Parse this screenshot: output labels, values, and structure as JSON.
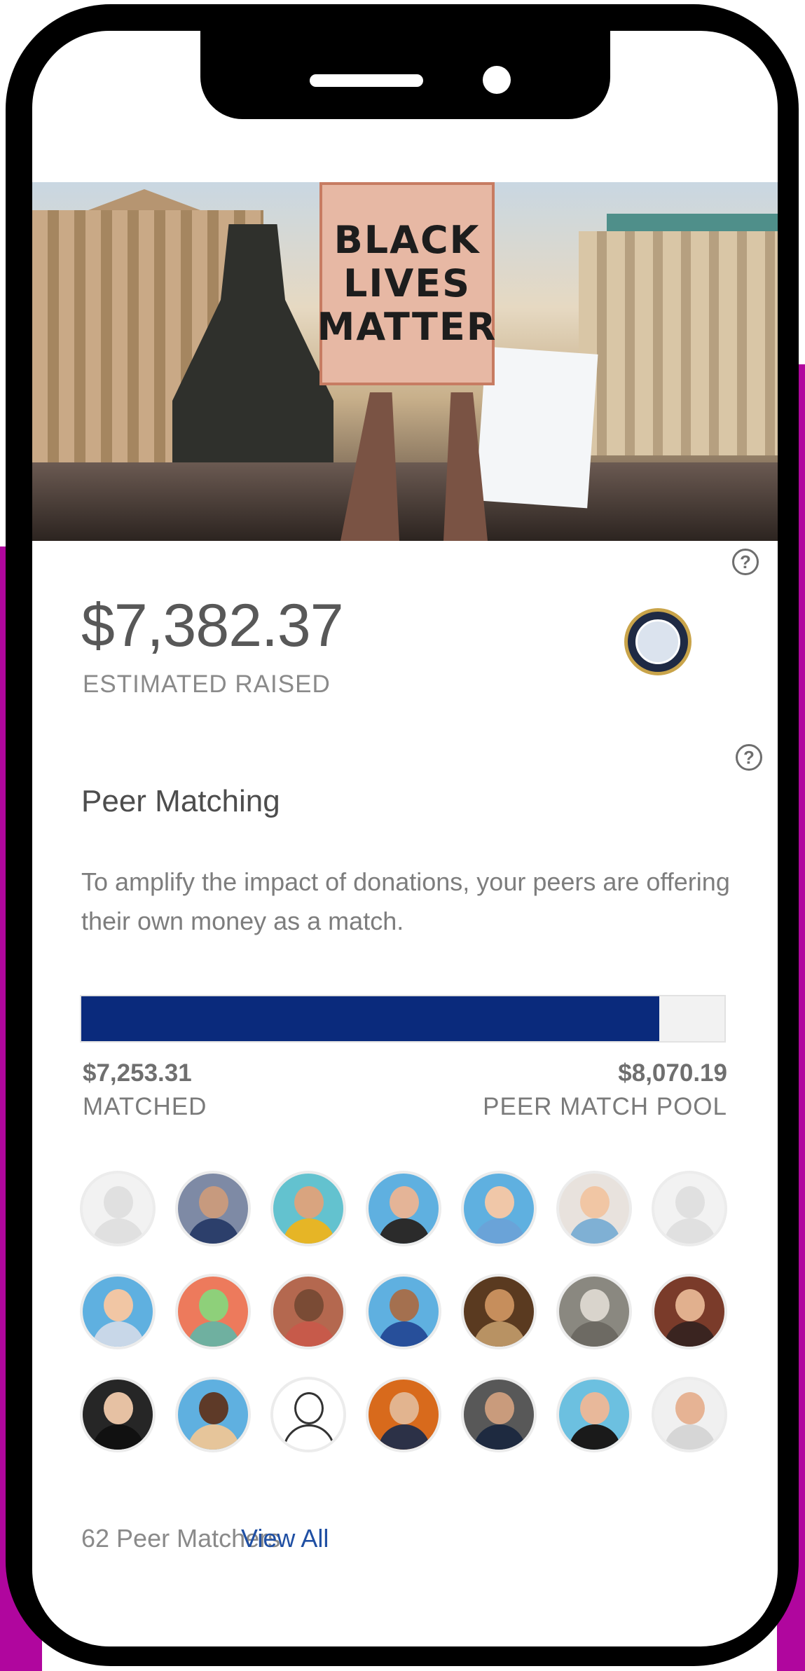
{
  "hero": {
    "sign_text": "BLACK LIVES MATTER"
  },
  "fundraiser": {
    "amount_raised": "$7,382.37",
    "amount_label": "ESTIMATED RAISED"
  },
  "peer_matching": {
    "title": "Peer Matching",
    "description": "To amplify the impact of donations, your peers are offering their own money as a match.",
    "progress_fraction": 0.899,
    "matched_amount": "$7,253.31",
    "matched_label": "MATCHED",
    "pool_amount": "$8,070.19",
    "pool_label": "PEER MATCH POOL",
    "matchers_count_text": "62 Peer Matchers",
    "view_all_label": "View All"
  },
  "help_icon_glyph": "?",
  "colors": {
    "progress_fill": "#0a2a7c",
    "link": "#1f4fa3"
  },
  "avatars": [
    {
      "type": "placeholder",
      "bg": "#f2f2f2",
      "skin": "#e0e0e0",
      "shirt": "#e0e0e0"
    },
    {
      "type": "photo",
      "bg": "#7e8aa5",
      "skin": "#c79a7e",
      "shirt": "#2c3f6b"
    },
    {
      "type": "photo",
      "bg": "#63c2cf",
      "skin": "#d9a47f",
      "shirt": "#e6b526"
    },
    {
      "type": "photo",
      "bg": "#5fb0e0",
      "skin": "#e4b497",
      "shirt": "#2b2b2b"
    },
    {
      "type": "photo",
      "bg": "#5fb0e0",
      "skin": "#f0c7a8",
      "shirt": "#6aa3d8"
    },
    {
      "type": "photo",
      "bg": "#e8e2dd",
      "skin": "#f1c6a4",
      "shirt": "#7fb0d4"
    },
    {
      "type": "placeholder",
      "bg": "#f2f2f2",
      "skin": "#e0e0e0",
      "shirt": "#e0e0e0"
    },
    {
      "type": "photo",
      "bg": "#5fb0e0",
      "skin": "#f1c6a4",
      "shirt": "#c8d7e8"
    },
    {
      "type": "photo",
      "bg": "#ed7a5c",
      "skin": "#8ed07a",
      "shirt": "#6fb0a0"
    },
    {
      "type": "photo",
      "bg": "#b4684f",
      "skin": "#7a4b35",
      "shirt": "#c75a4a"
    },
    {
      "type": "photo",
      "bg": "#5fb0e0",
      "skin": "#a4704f",
      "shirt": "#274f9a"
    },
    {
      "type": "photo",
      "bg": "#5a3a20",
      "skin": "#c68e5c",
      "shirt": "#b89263"
    },
    {
      "type": "photo",
      "bg": "#8a8880",
      "skin": "#d9d4cc",
      "shirt": "#6d6a63"
    },
    {
      "type": "photo",
      "bg": "#7a3b2a",
      "skin": "#e1b08e",
      "shirt": "#3a2420"
    },
    {
      "type": "photo",
      "bg": "#262626",
      "skin": "#e6c1a3",
      "shirt": "#111111"
    },
    {
      "type": "photo",
      "bg": "#5fb0e0",
      "skin": "#5e3a28",
      "shirt": "#e6c59a"
    },
    {
      "type": "photo",
      "bg": "#ffffff",
      "skin": "#ffffff",
      "shirt": "#ffffff"
    },
    {
      "type": "photo",
      "bg": "#d86a1c",
      "skin": "#e2b48f",
      "shirt": "#2c3147"
    },
    {
      "type": "photo",
      "bg": "#585858",
      "skin": "#c99b7c",
      "shirt": "#1e2a40"
    },
    {
      "type": "photo",
      "bg": "#6cc0e0",
      "skin": "#e8b89a",
      "shirt": "#1a1a1a"
    },
    {
      "type": "photo",
      "bg": "#f0f0f0",
      "skin": "#e6b394",
      "shirt": "#d6d6d6"
    }
  ]
}
